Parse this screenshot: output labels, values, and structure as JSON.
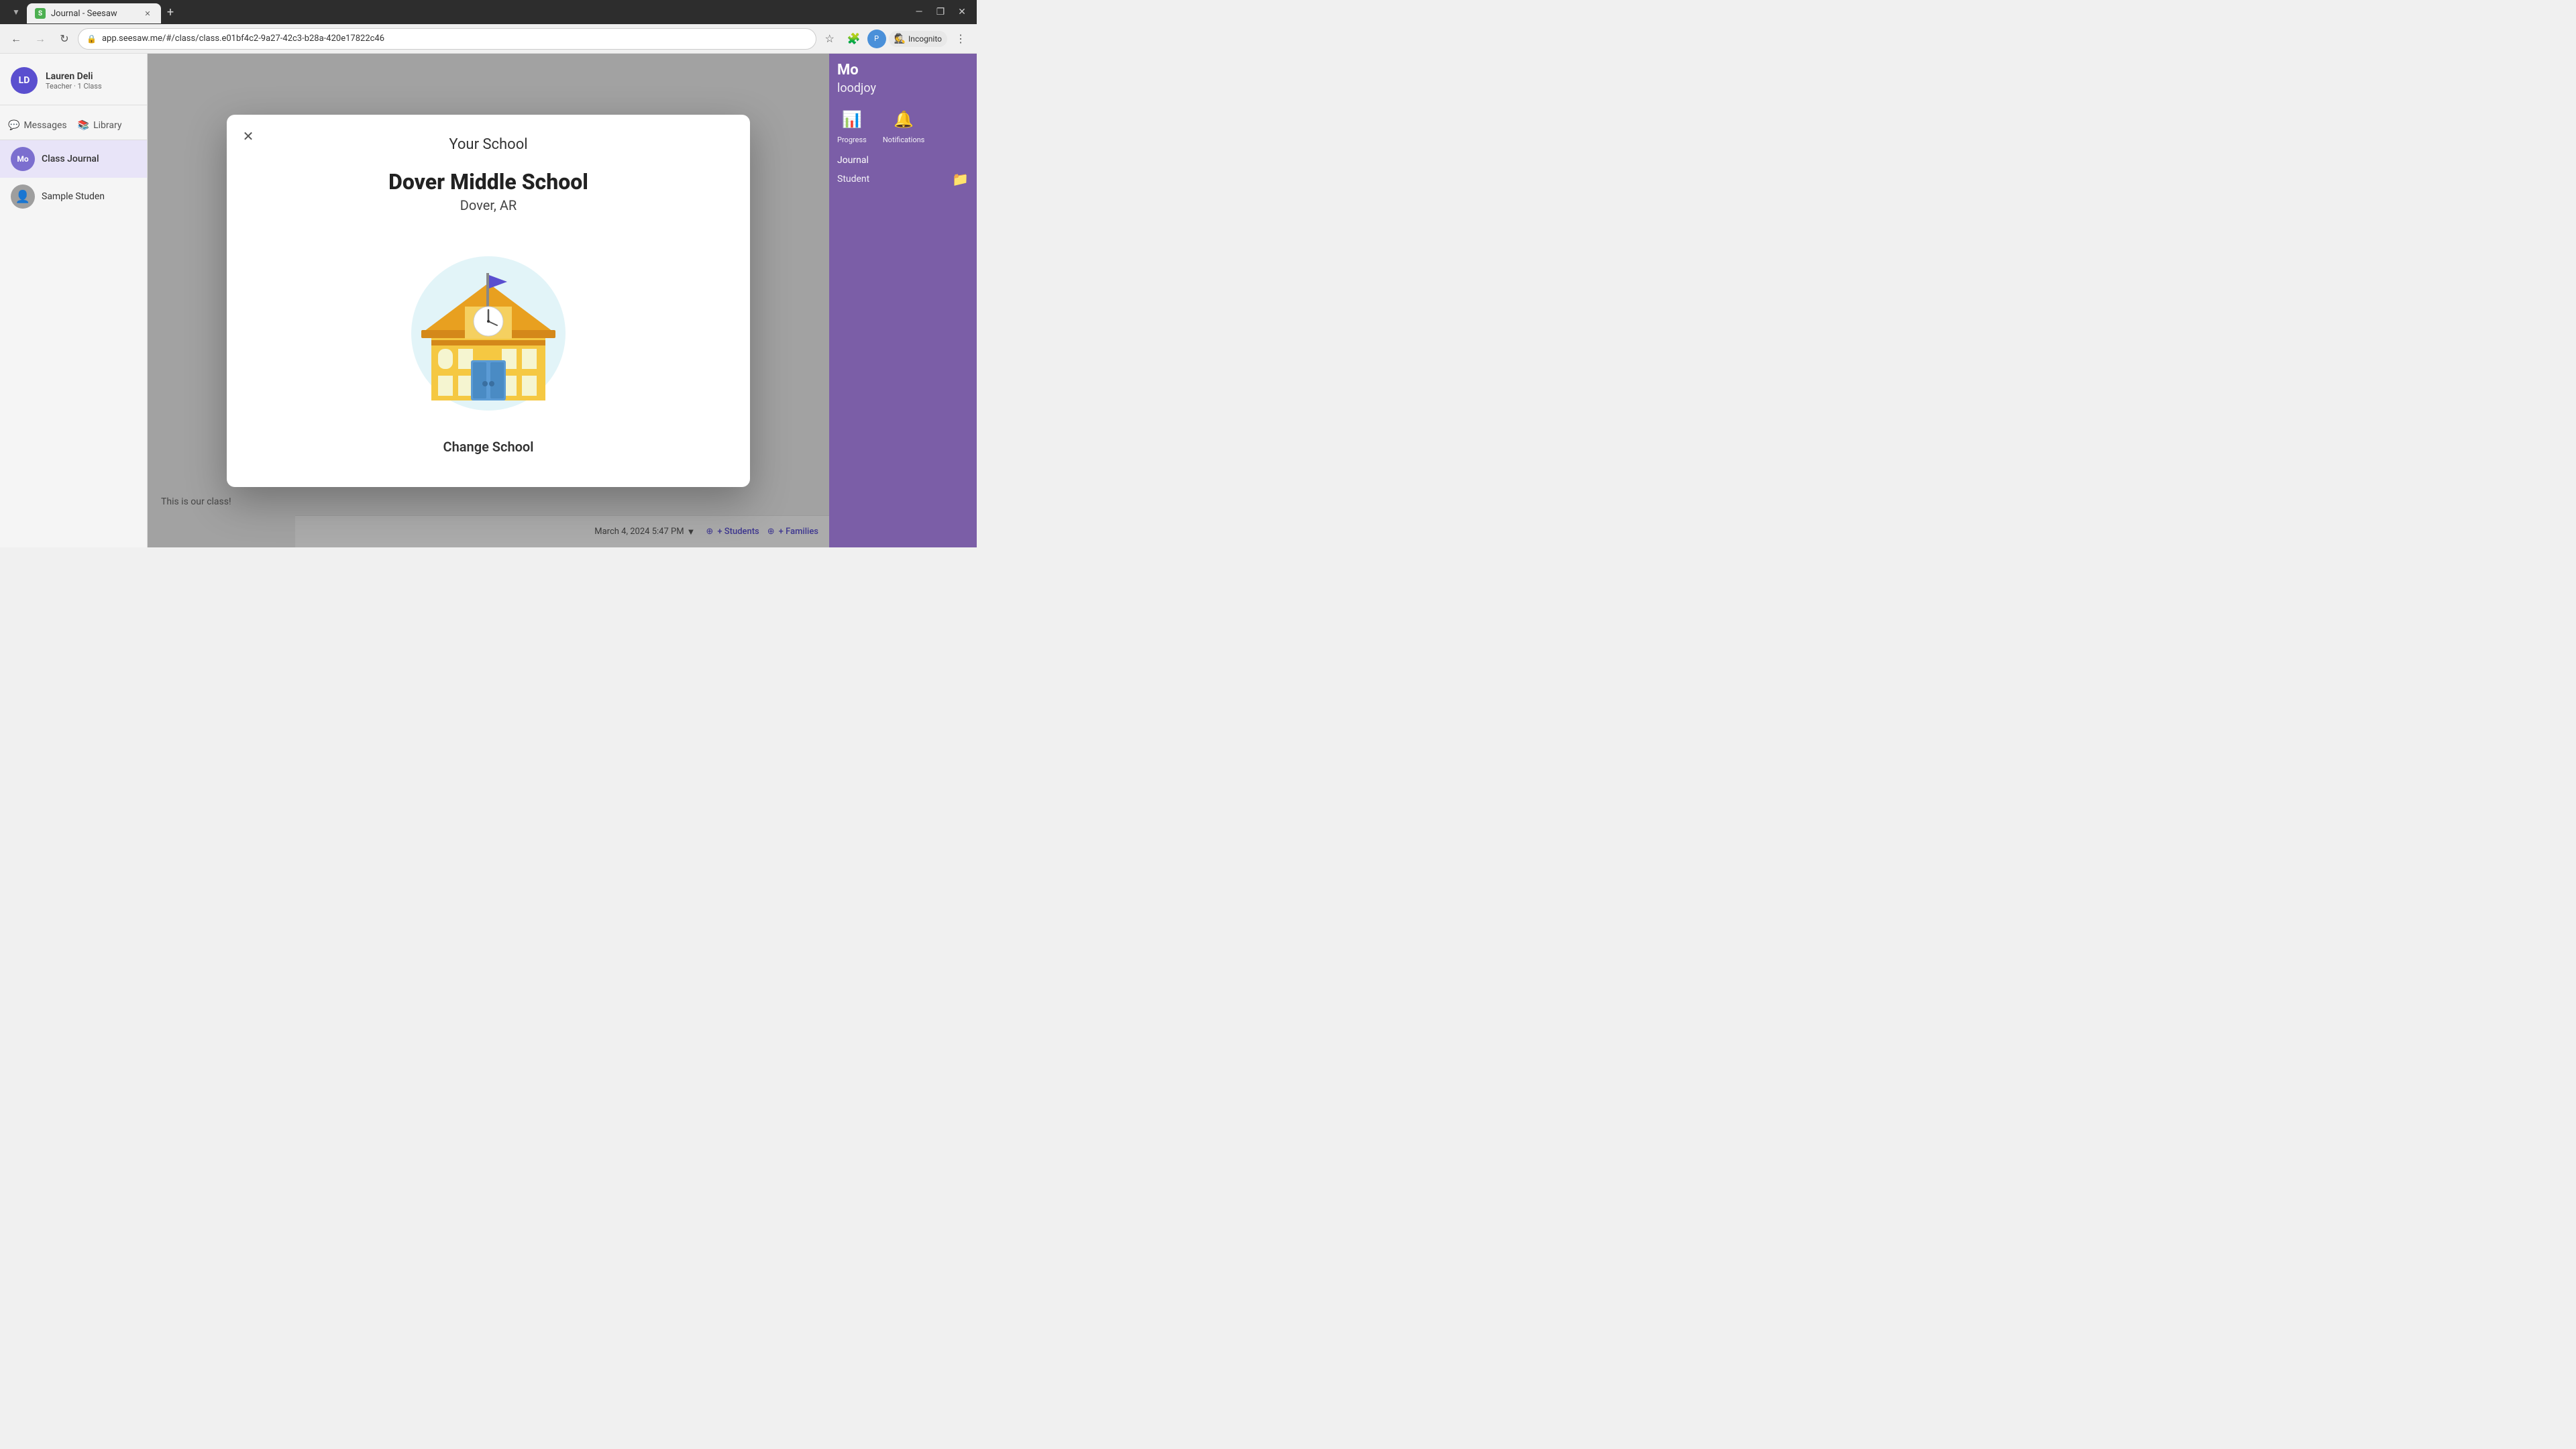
{
  "browser": {
    "tab_label": "Journal - Seesaw",
    "tab_favicon": "S",
    "address": "app.seesaw.me/#/class/class.e01bf4c2-9a27-42c3-b28a-420e17822c46",
    "incognito_label": "Incognito",
    "new_tab_icon": "+",
    "nav_back": "←",
    "nav_forward": "→",
    "nav_refresh": "↻",
    "window_minimize": "—",
    "window_maximize": "❐",
    "window_close": "✕"
  },
  "sidebar": {
    "user_initials": "LD",
    "user_name": "Lauren Deli",
    "user_role": "Teacher · 1 Class",
    "class_journal_initials": "Mo",
    "class_journal_label": "Class Journal",
    "student_label": "Sample Studen",
    "student_icon": "👤"
  },
  "topnav": {
    "messages_label": "Messages",
    "library_label": "Library"
  },
  "right_panel": {
    "header": "Mo",
    "subheader": "loodjoy",
    "progress_label": "Progress",
    "notifications_label": "Notifications",
    "journal_label": "Journal",
    "student_label": "Student",
    "folder_icon": "📁"
  },
  "modal": {
    "title": "Your School",
    "school_name": "Dover Middle School",
    "school_location": "Dover, AR",
    "change_school_label": "Change School",
    "close_icon": "✕"
  },
  "footer": {
    "date_label": "March 4, 2024 5:47 PM",
    "students_label": "+ Students",
    "families_label": "+ Families",
    "class_text": "This is our class!"
  }
}
